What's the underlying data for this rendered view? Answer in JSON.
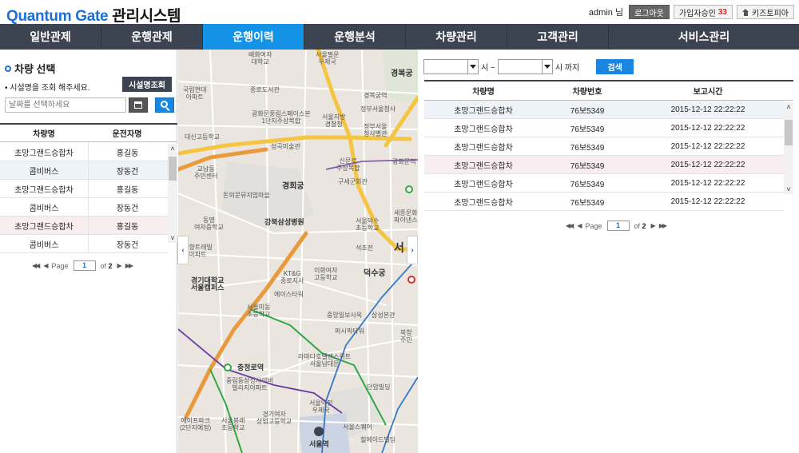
{
  "header": {
    "logo_brand": "Quantum Gate",
    "logo_suffix": "관리시스템",
    "user_label": "admin 님",
    "logout_label": "로그아웃",
    "signup_label": "가입자승인",
    "signup_count": "33",
    "kidstopia_label": "키즈토피아"
  },
  "nav": {
    "items": [
      {
        "label": "일반관제"
      },
      {
        "label": "운행관제"
      },
      {
        "label": "운행이력",
        "active": true
      },
      {
        "label": "운행분석"
      },
      {
        "label": "차량관리"
      },
      {
        "label": "고객관리"
      },
      {
        "label": "서비스관리"
      }
    ]
  },
  "left": {
    "title": "차량 선택",
    "desc": "• 시설명을 조회 해주세요.",
    "facility_button": "시설명조회",
    "search_placeholder": "날짜를 선택하세요",
    "columns": [
      "차량명",
      "운전자명"
    ],
    "rows": [
      [
        "초망그랜드승합차",
        "홍길동"
      ],
      [
        "콤비버스",
        "장동건"
      ],
      [
        "초망그랜드승합차",
        "홍길동"
      ],
      [
        "콤비버스",
        "장동건"
      ],
      [
        "초망그랜드승합차",
        "홍길동"
      ],
      [
        "콤비버스",
        "장동건"
      ]
    ],
    "pager": {
      "page_label": "Page",
      "current": "1",
      "of_label": "of",
      "total": "2"
    }
  },
  "map": {
    "labels": {
      "l1": "배화여자\n대학교",
      "l2": "서울필운\n우체국",
      "l3": "경복궁",
      "l4": "국립현대\n아파트",
      "l5": "종로도서관",
      "l6": "경복궁역",
      "l7": "정부서울청사",
      "l8": "광화문풍림스페이스본\n1단지주상복합",
      "l9": "서울지방\n경찰청",
      "l10": "정부서울\n청사별관",
      "l11": "대신고등학교",
      "l12": "성곡미술관",
      "l13": "교남동\n주민센터",
      "l14": "경희궁",
      "l15": "신문로\n주상복합",
      "l16": "광화문역",
      "l17": "돈의문뮤지엄마을",
      "l18": "구세군회관",
      "l19": "강북삼성병원",
      "l20": "동명\n여자중학교",
      "l21": "서울덕수\n초등학교",
      "l22": "세종문화\n파이낸스",
      "l23": "경향트레빌\n아파트",
      "l24": "석조전",
      "l25": "서",
      "l26": "경기대학교\n서울캠퍼스",
      "l27": "KT&G\n종로지사",
      "l28": "이화여자\n고등학교",
      "l29": "덕수궁",
      "l30": "에이스타워",
      "l31": "서울미동\n초등학교",
      "l32": "중앙일보사옥",
      "l33": "삼성본관",
      "l34": "퍼시픽타워",
      "l35": "라마다호텔앤스위트\n서울남대문",
      "l36": "충정로역",
      "l37": "중림동삼성사이버\n빌리지아파트",
      "l38": "단암빌딩",
      "l39": "서울역전\n우체국",
      "l40": "경기여자\n상업고등학교",
      "l41": "서울봉래\n초등학교",
      "l42": "서울스퀘어",
      "l43": "힐에이드빌딩",
      "l44": "서울역",
      "l45": "에이프파크\n(2단지예정)",
      "l46": "북창\n주민",
      "l47": "경복궁역"
    }
  },
  "right": {
    "from_suffix": "시 ~",
    "to_suffix": "시 까지",
    "search_button": "검색",
    "columns": [
      "차량명",
      "차량번호",
      "보고시간"
    ],
    "rows": [
      [
        "초망그랜드승합차",
        "76보5349",
        "2015-12-12 22:22:22"
      ],
      [
        "초망그랜드승합차",
        "76보5349",
        "2015-12-12 22:22:22"
      ],
      [
        "초망그랜드승합차",
        "76보5349",
        "2015-12-12 22:22:22"
      ],
      [
        "초망그랜드승합차",
        "76보5349",
        "2015-12-12 22:22:22"
      ],
      [
        "초망그랜드승합차",
        "76보5349",
        "2015-12-12 22:22:22"
      ],
      [
        "초망그랜드승합차",
        "76보5349",
        "2015-12-12 22:22:22"
      ]
    ],
    "pager": {
      "page_label": "Page",
      "current": "1",
      "of_label": "of",
      "total": "2"
    }
  }
}
